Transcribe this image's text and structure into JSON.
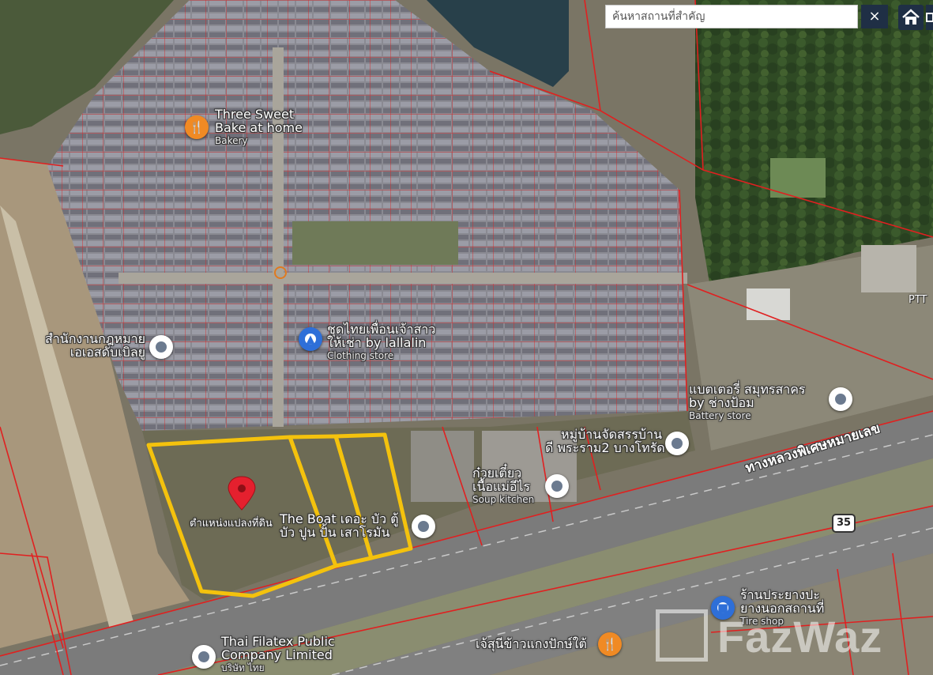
{
  "search": {
    "placeholder": "ค้นหาสถานที่สำคัญ",
    "clear_label": "×"
  },
  "road": {
    "name": "ทางหลวงพิเศษหมายเลข",
    "shield_number": "35"
  },
  "watermark": {
    "text": "FazWaz"
  },
  "colors": {
    "plot_outline": "#f4c20d",
    "parcel_lines": "#e02020",
    "selected_pin": "#e5202e",
    "ui_dark": "#1f2f45"
  },
  "places": [
    {
      "id": "bakery",
      "name_line1": "Three Sweet",
      "name_line2": "Bake at home",
      "category": "Bakery",
      "icon": "fork-knife-icon"
    },
    {
      "id": "law-office",
      "name_line1": "สำนักงานกฎหมาย",
      "name_line2": "เอเอสดับเบิลยู",
      "category": "",
      "icon": "pin-icon"
    },
    {
      "id": "clothing",
      "name_line1": "ชุดไทยเพื่อนเจ้าสาว",
      "name_line2": "ให้เช่า by lallalin",
      "category": "Clothing store",
      "icon": "shopping-bag-icon"
    },
    {
      "id": "battery",
      "name_line1": "แบตเตอรี่ สมุทรสาคร",
      "name_line2": "by ช่างป้อม",
      "category": "Battery store",
      "icon": "pin-icon"
    },
    {
      "id": "village",
      "name_line1": "หมู่บ้านจัดสรรบ้าน",
      "name_line2": "ดี พระราม2 บางโทรัด",
      "category": "",
      "icon": "pin-icon"
    },
    {
      "id": "soup",
      "name_line1": "ก๋วยเตี๋ยว",
      "name_line2": "เนื้อแม่อีไร",
      "category": "Soup kitchen",
      "icon": "pin-icon"
    },
    {
      "id": "boat",
      "name_line1": "The Boat เดอะ บัว ตู้",
      "name_line2": "บัว ปูน ปั้น เสาโรมัน",
      "category": "",
      "icon": "pin-icon"
    },
    {
      "id": "tire",
      "name_line1": "ร้านประยางปะ",
      "name_line2": "ยางนอกสถานที่",
      "category": "Tire shop",
      "icon": "car-icon"
    },
    {
      "id": "filatex",
      "name_line1": "Thai Filatex Public",
      "name_line2": "Company Limited",
      "category": "บริษัท ไทย",
      "icon": "pin-icon"
    },
    {
      "id": "congee",
      "name_line1": "เจ้สุนีข้าวแกงปักษ์ใต้",
      "name_line2": "",
      "category": "",
      "icon": "fork-knife-icon"
    },
    {
      "id": "ptt",
      "name_line1": "PTT",
      "name_line2": "",
      "category": "",
      "icon": ""
    }
  ],
  "selected_plot": {
    "label": "ตำแหน่งแปลงที่ดิน"
  }
}
